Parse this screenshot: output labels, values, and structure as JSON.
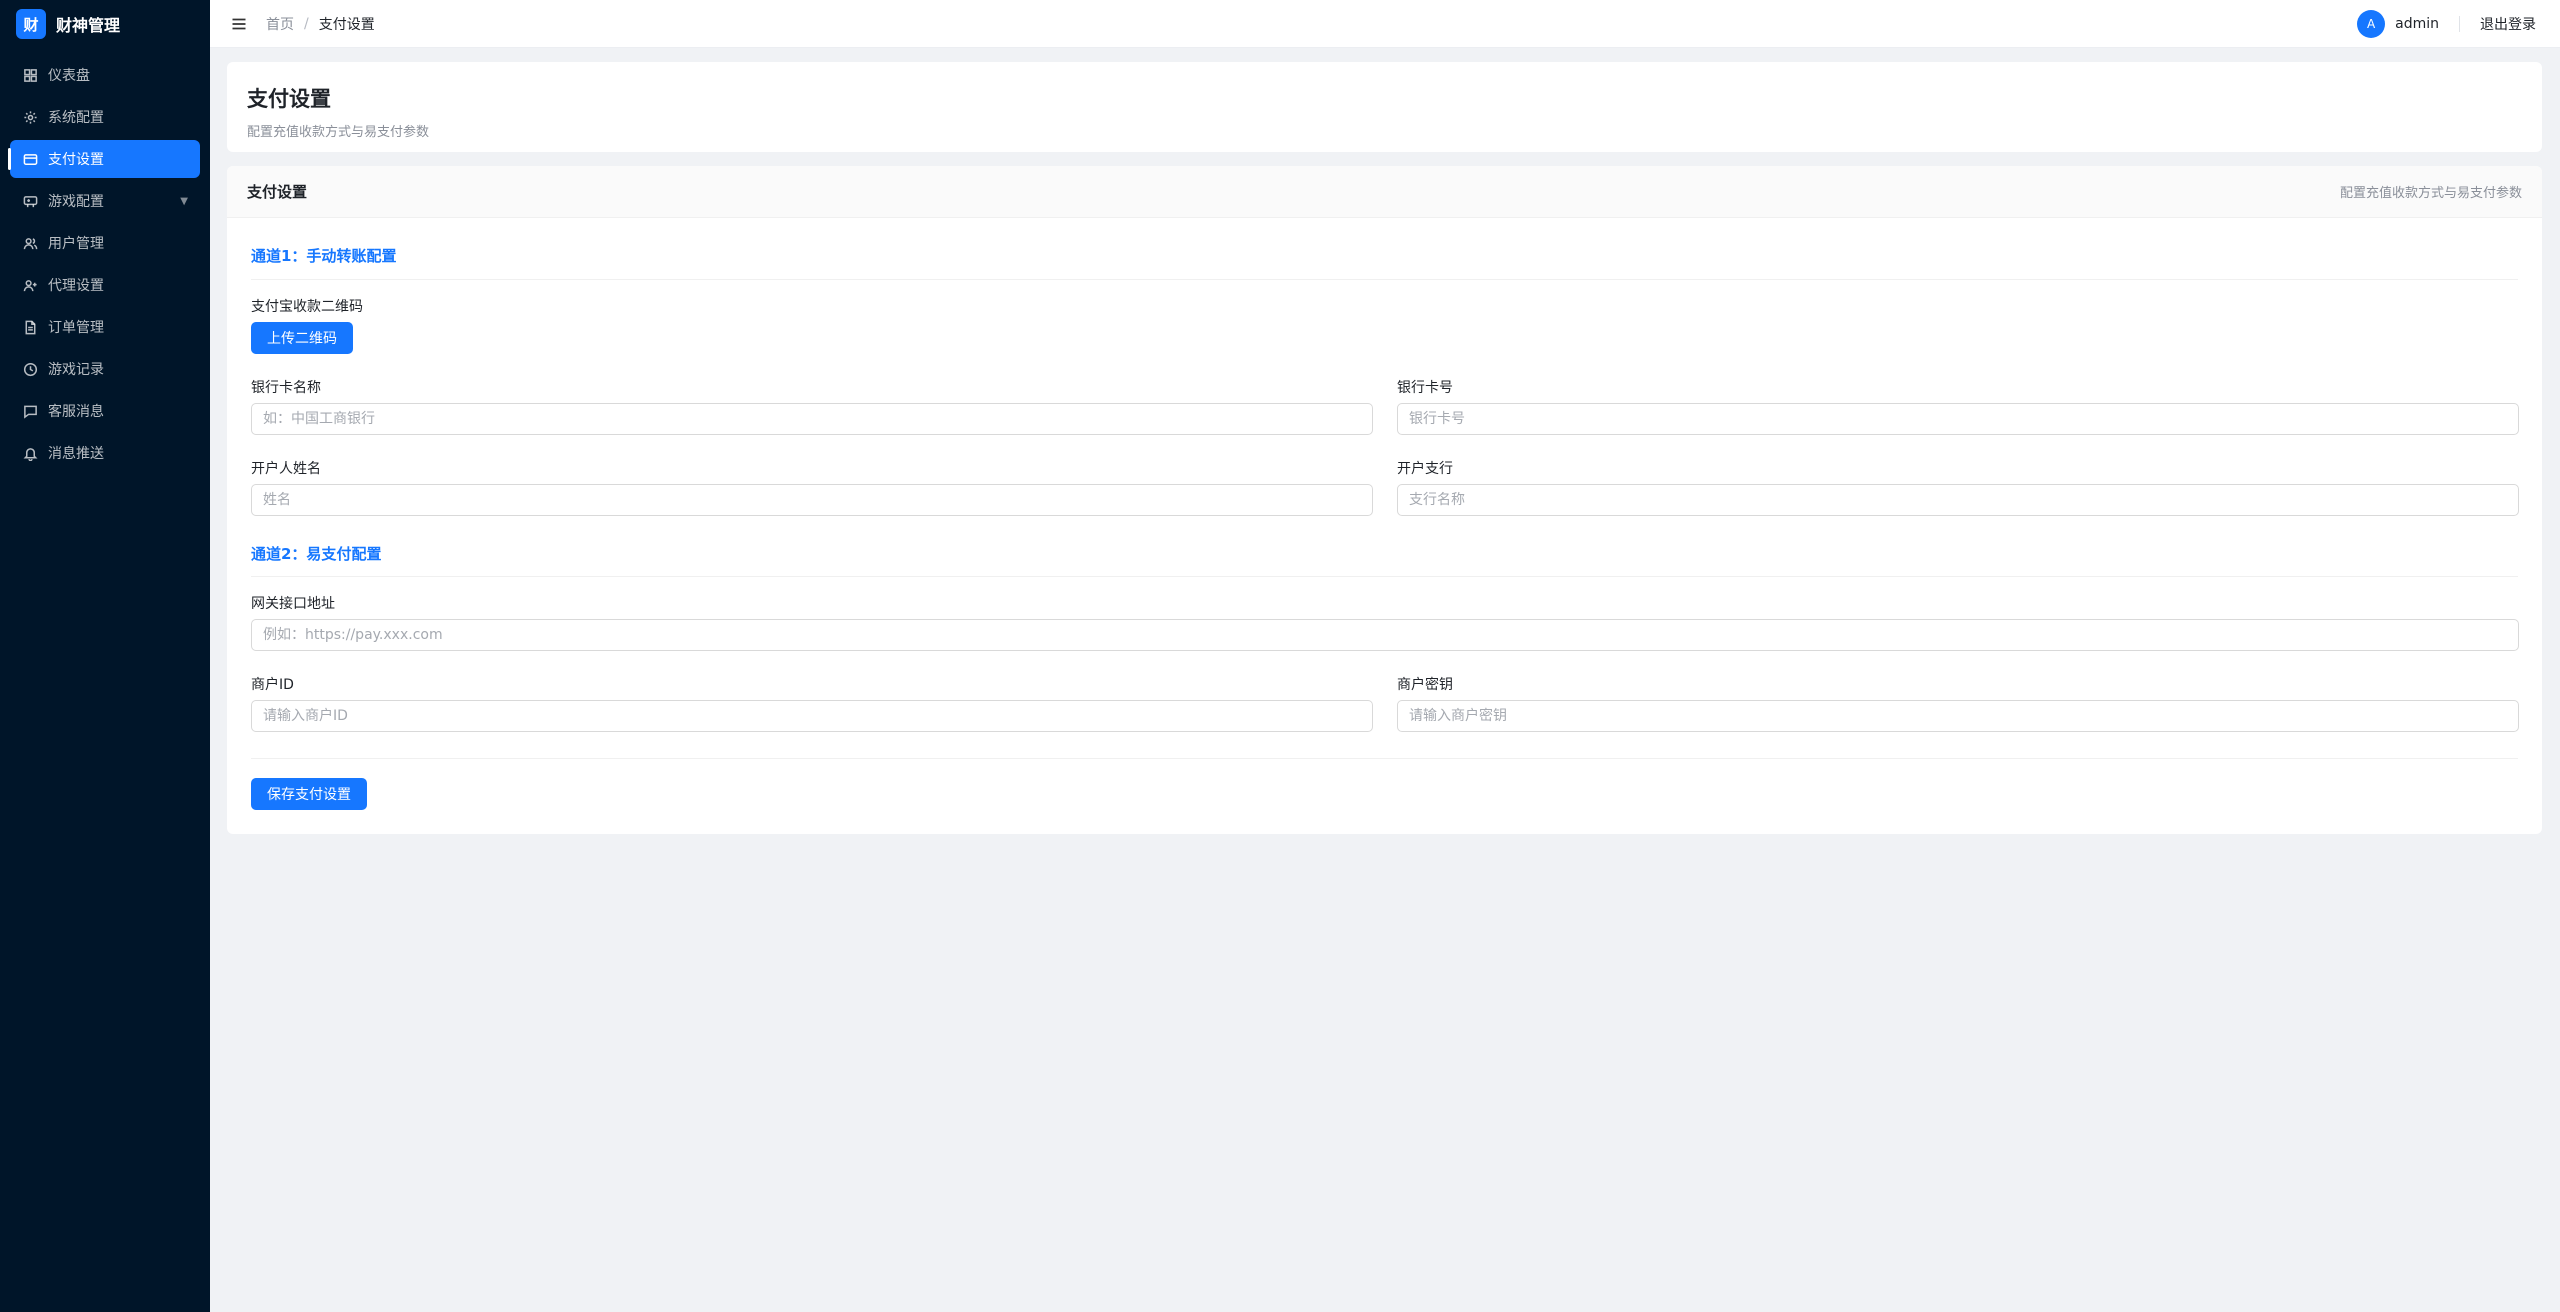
{
  "brand": {
    "logo_char": "财",
    "name": "财神管理"
  },
  "sidebar": {
    "items": [
      {
        "label": "仪表盘",
        "icon": "dashboard-icon"
      },
      {
        "label": "系统配置",
        "icon": "gear-icon"
      },
      {
        "label": "支付设置",
        "icon": "credit-card-icon",
        "active": true
      },
      {
        "label": "游戏配置",
        "icon": "game-icon",
        "has_submenu": true
      },
      {
        "label": "用户管理",
        "icon": "users-icon"
      },
      {
        "label": "代理设置",
        "icon": "user-add-icon"
      },
      {
        "label": "订单管理",
        "icon": "document-icon"
      },
      {
        "label": "游戏记录",
        "icon": "clock-icon"
      },
      {
        "label": "客服消息",
        "icon": "message-icon"
      },
      {
        "label": "消息推送",
        "icon": "bell-icon"
      }
    ],
    "submenu_arrow": "▼"
  },
  "header": {
    "breadcrumb": {
      "home": "首页",
      "separator": "/",
      "current": "支付设置"
    },
    "avatar_initial": "A",
    "username": "admin",
    "logout_label": "退出登录"
  },
  "page": {
    "title": "支付设置",
    "subtitle": "配置充值收款方式与易支付参数"
  },
  "card": {
    "title": "支付设置",
    "extra": "配置充值收款方式与易支付参数",
    "channel1": {
      "title": "通道1：手动转账配置",
      "alipay_qr_label": "支付宝收款二维码",
      "upload_button": "上传二维码",
      "bank_name_label": "银行卡名称",
      "bank_name_placeholder": "如：中国工商银行",
      "bank_card_label": "银行卡号",
      "bank_card_placeholder": "银行卡号",
      "holder_label": "开户人姓名",
      "holder_placeholder": "姓名",
      "branch_label": "开户支行",
      "branch_placeholder": "支行名称"
    },
    "channel2": {
      "title": "通道2：易支付配置",
      "gateway_label": "网关接口地址",
      "gateway_placeholder": "例如：https://pay.xxx.com",
      "merchant_id_label": "商户ID",
      "merchant_id_placeholder": "请输入商户ID",
      "merchant_key_label": "商户密钥",
      "merchant_key_placeholder": "请输入商户密钥"
    },
    "save_button": "保存支付设置"
  },
  "colors": {
    "primary": "#1677ff",
    "sidebar_bg": "#001529",
    "page_bg": "#f0f2f5"
  }
}
